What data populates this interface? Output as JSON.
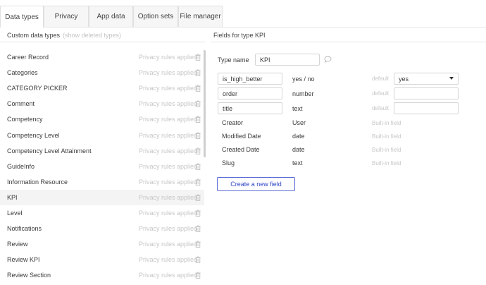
{
  "tabs": [
    {
      "label": "Data types",
      "active": true
    },
    {
      "label": "Privacy",
      "active": false
    },
    {
      "label": "App data",
      "active": false
    },
    {
      "label": "Option sets",
      "active": false
    },
    {
      "label": "File manager",
      "active": false
    }
  ],
  "left_panel": {
    "title": "Custom data types",
    "show_deleted": "(show deleted types)",
    "privacy_text": "Privacy rules applied",
    "selected": "KPI",
    "types": [
      "Career Record",
      "Categories",
      "CATEGORY PICKER",
      "Comment",
      "Competency",
      "Competency Level",
      "Competency Level Attainment",
      "GuideInfo",
      "Information Resource",
      "KPI",
      "Level",
      "Notifications",
      "Review",
      "Review KPI",
      "Review Section"
    ]
  },
  "right_panel": {
    "title": "Fields for type KPI",
    "type_name_label": "Type name",
    "type_name_value": "KPI",
    "default_label": "default",
    "builtin_label": "Built-in field",
    "custom_fields": [
      {
        "name": "is_high_better",
        "type": "yes / no",
        "default_value": "yes"
      },
      {
        "name": "order",
        "type": "number",
        "default_value": ""
      },
      {
        "name": "title",
        "type": "text",
        "default_value": ""
      }
    ],
    "builtin_fields": [
      {
        "name": "Creator",
        "type": "User"
      },
      {
        "name": "Modified Date",
        "type": "date"
      },
      {
        "name": "Created Date",
        "type": "date"
      },
      {
        "name": "Slug",
        "type": "text"
      }
    ],
    "create_button": "Create a new field"
  },
  "colors": {
    "accent": "#2f45c6",
    "muted_text": "#c7c7c7",
    "selected_row": "#f4f4f4"
  }
}
